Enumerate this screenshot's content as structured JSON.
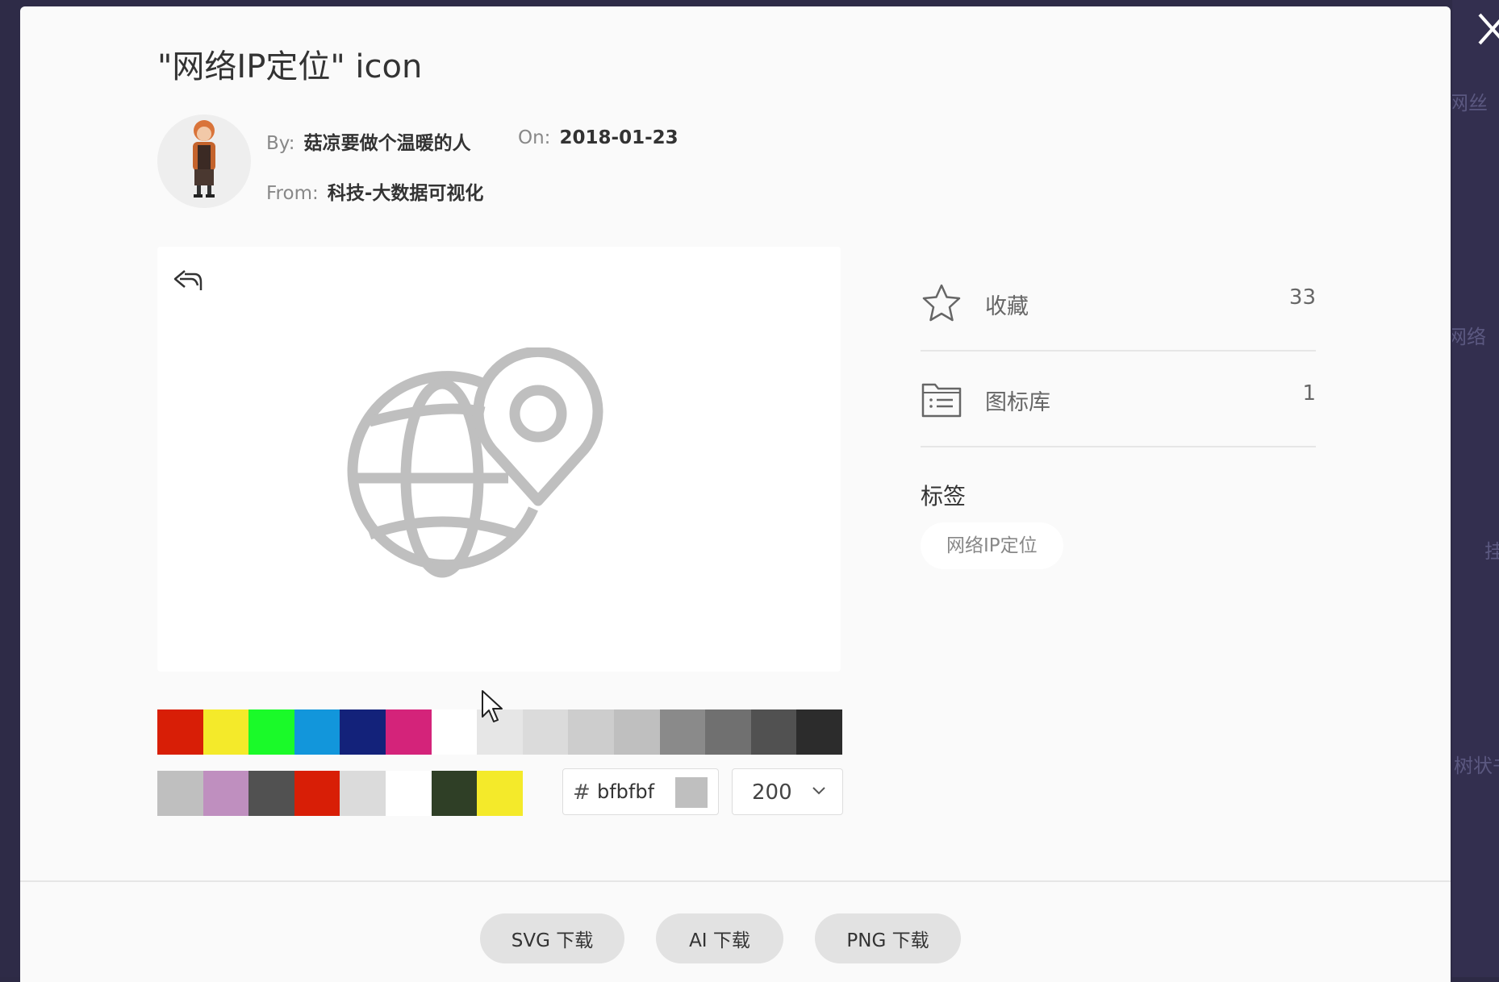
{
  "dialog": {
    "title": "\"网络IP定位\" icon",
    "close_icon": "close-icon"
  },
  "author": {
    "by_label": "By:",
    "by_value": "菇凉要做个温暖的人",
    "on_label": "On:",
    "on_value": "2018-01-23",
    "from_label": "From:",
    "from_value": "科技-大数据可视化"
  },
  "preview": {
    "undo_icon": "undo-icon",
    "icon_name": "globe-location-pin-icon",
    "icon_color": "#bfbfbf"
  },
  "palette": {
    "row1": [
      "#d81e06",
      "#f4ea2a",
      "#1afa29",
      "#1296db",
      "#13227a",
      "#d4237a",
      "#ffffff",
      "#e6e6e6",
      "#dbdbdb",
      "#cdcdcd",
      "#bfbfbf",
      "#8a8a8a",
      "#707070",
      "#515151",
      "#2c2c2c"
    ],
    "row2": [
      "#bfbfbf",
      "#bf8fbf",
      "#515151",
      "#d81e06",
      "#dbdbdb",
      "#ffffff",
      "#2f3f26",
      "#f4ea2a"
    ]
  },
  "color_input": {
    "hash": "#",
    "value": "bfbfbf"
  },
  "size_select": {
    "value": "200"
  },
  "stats": [
    {
      "icon": "star-icon",
      "label": "收藏",
      "count": "33"
    },
    {
      "icon": "library-icon",
      "label": "图标库",
      "count": "1"
    }
  ],
  "tags": {
    "heading": "标签",
    "items": [
      "网络IP定位"
    ]
  },
  "downloads": {
    "svg": "SVG 下载",
    "ai": "AI 下载",
    "png": "PNG 下载"
  },
  "background_peek": [
    "网丝",
    "网络",
    "挂",
    "树状书"
  ]
}
